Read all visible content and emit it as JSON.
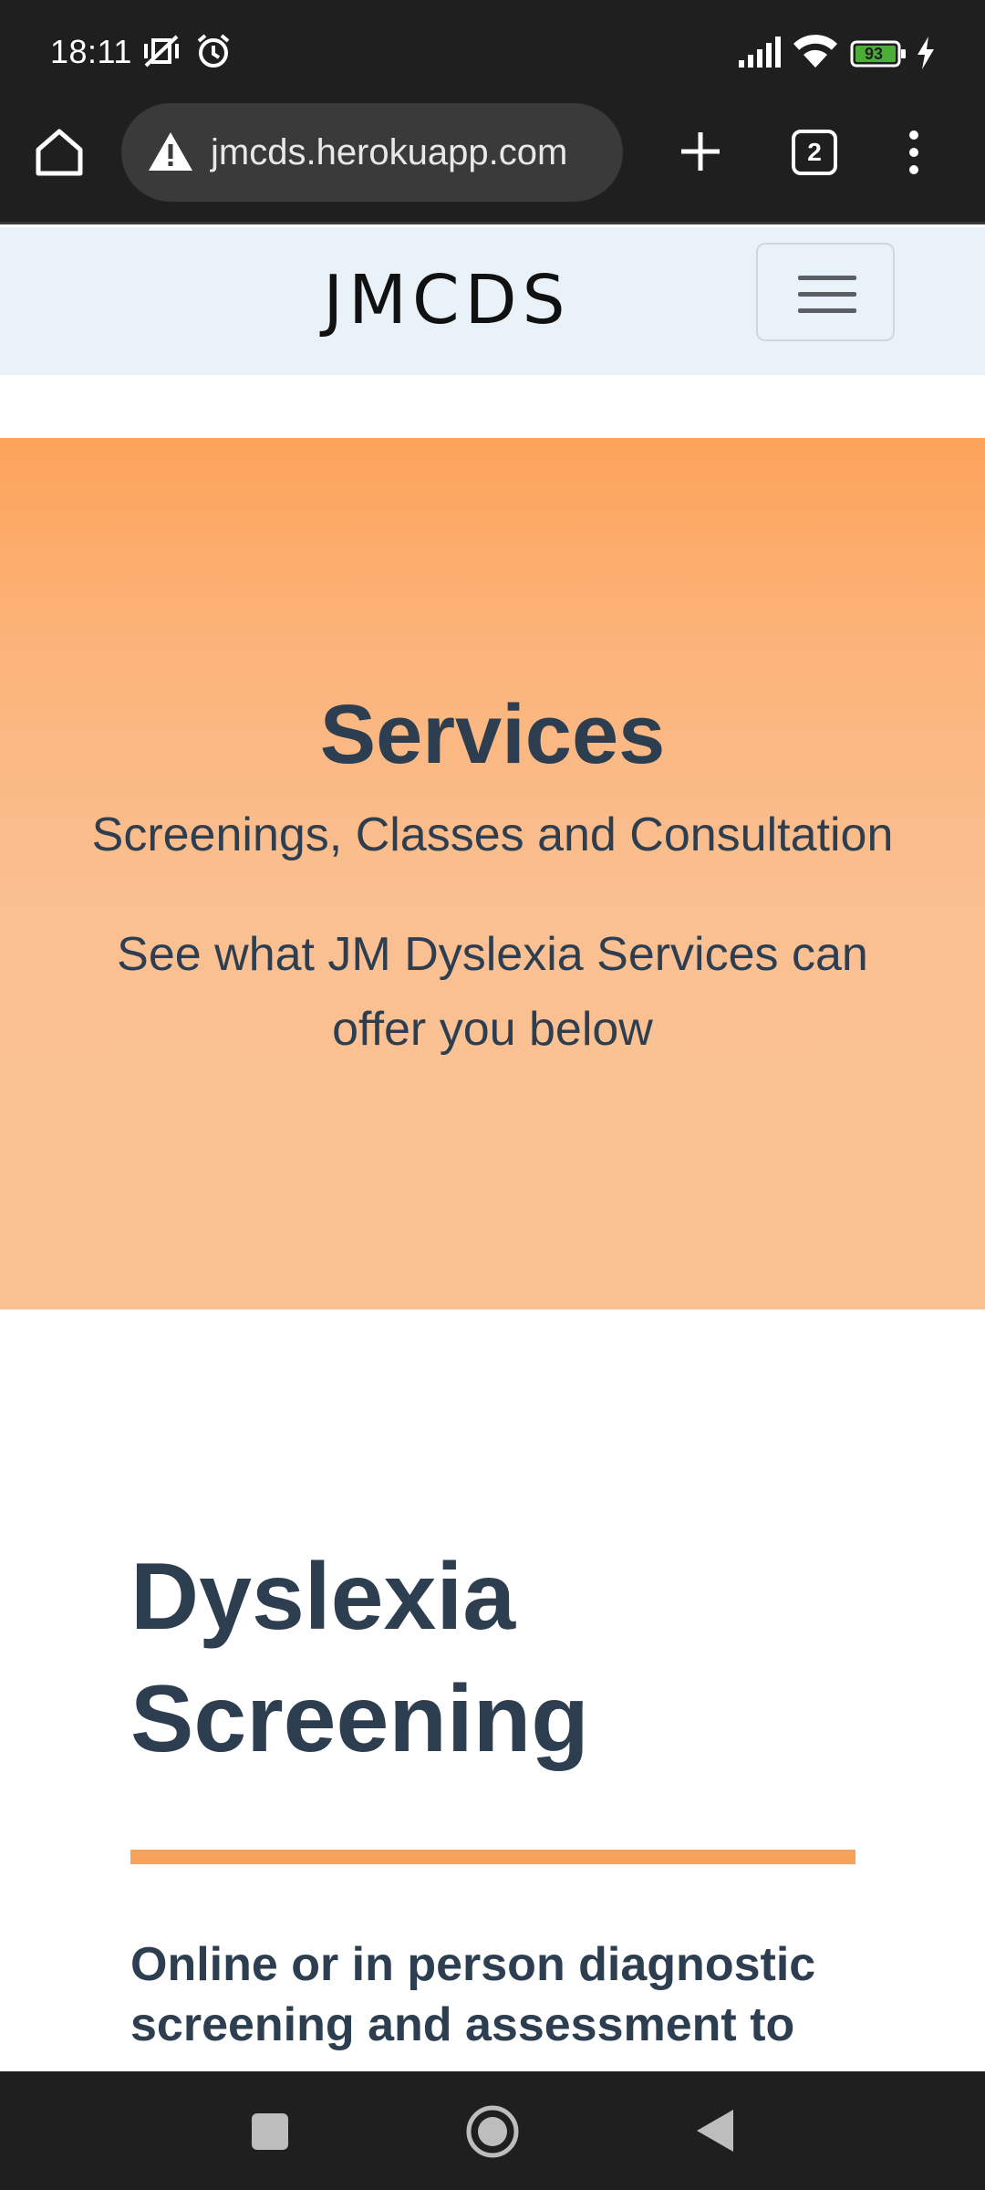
{
  "status_bar": {
    "time": "18:11",
    "battery_level": "93",
    "icons": [
      "vibrate-off-icon",
      "alarm-icon",
      "signal-icon",
      "wifi-icon",
      "battery-icon",
      "charging-icon"
    ]
  },
  "browser": {
    "url": "jmcds.herokuapp.com",
    "tab_count": "2",
    "icons": [
      "home-icon",
      "warning-icon",
      "new-tab-icon",
      "tab-switcher-icon",
      "more-menu-icon"
    ]
  },
  "navbar": {
    "brand": "JMCDS",
    "menu_icon": "hamburger-icon"
  },
  "hero": {
    "title": "Services",
    "subtitle": "Screenings, Classes and Consultation",
    "text": "See what JM Dyslexia Services can offer you below"
  },
  "section": {
    "title": "Dyslexia Screening",
    "lead": "Online or in person diagnostic screening and assessment to"
  },
  "colors": {
    "heading": "#2c3e50",
    "accent": "#f6a25a",
    "navbar_bg": "#e9f2f8",
    "chrome_bg": "#1f1f1f"
  }
}
